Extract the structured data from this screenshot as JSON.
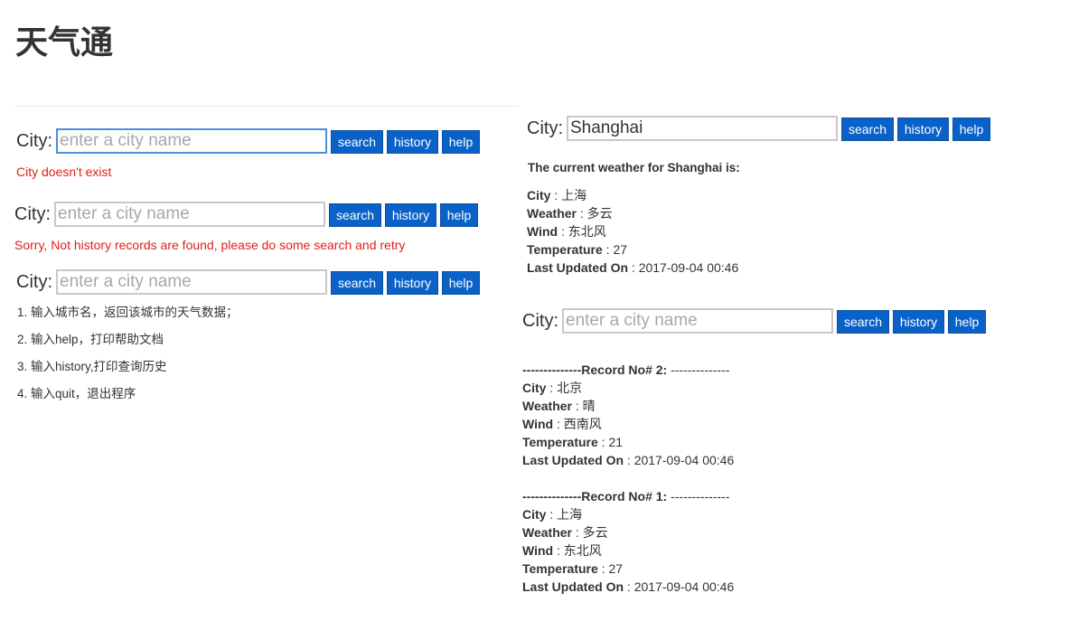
{
  "app_title": "天气通",
  "city_label": "City:",
  "placeholder": "enter a city name",
  "buttons": {
    "search": "search",
    "history": "history",
    "help": "help"
  },
  "panel1": {
    "error": "City doesn't exist"
  },
  "panel2": {
    "error": "Sorry, Not history records are found, please do some search and retry"
  },
  "panel3": {
    "help_lines": [
      "1. 输入城市名，返回该城市的天气数据；",
      "2. 输入help，打印帮助文档",
      "3. 输入history,打印查询历史",
      "4. 输入quit，退出程序"
    ]
  },
  "field_labels": {
    "city": "City",
    "weather": "Weather",
    "wind": "Wind",
    "temperature": "Temperature",
    "updated": "Last Updated On",
    "sep": " : "
  },
  "panel4": {
    "input_value": "Shanghai",
    "heading": "The current weather for Shanghai is:",
    "city": "上海",
    "weather": "多云",
    "wind": "东北风",
    "temperature": "27",
    "updated": "2017-09-04 00:46"
  },
  "panel5": {
    "records": [
      {
        "header_dashes": "--------------",
        "header_label": "Record No# 2:",
        "header_tail": " --------------",
        "city": "北京",
        "weather": "晴",
        "wind": "西南风",
        "temperature": "21",
        "updated": "2017-09-04 00:46"
      },
      {
        "header_dashes": "--------------",
        "header_label": "Record No# 1:",
        "header_tail": " --------------",
        "city": "上海",
        "weather": "多云",
        "wind": "东北风",
        "temperature": "27",
        "updated": "2017-09-04 00:46"
      }
    ]
  },
  "colors": {
    "button_bg": "#0a62c8",
    "error_text": "#e0201a",
    "focus_border": "#4a90d9"
  }
}
